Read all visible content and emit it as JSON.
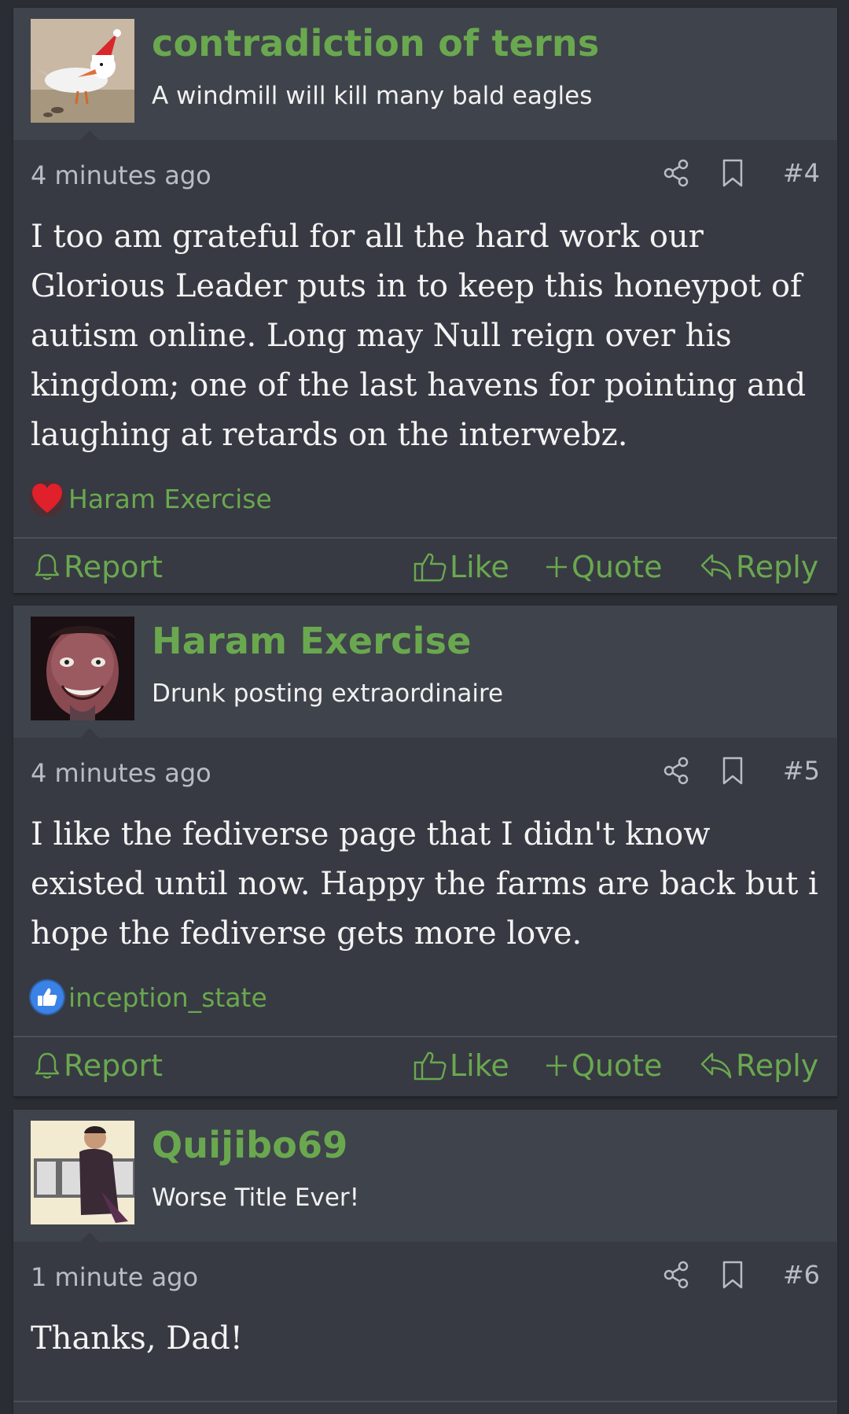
{
  "posts": [
    {
      "username": "contradiction of terns",
      "user_title": "A windmill will kill many bald eagles",
      "timestamp": "4 minutes ago",
      "post_number": "#4",
      "message": "I too am grateful for all the hard work our Glorious Leader puts in to keep this honeypot of autism online. Long may Null reign over his kingdom; one of the last havens for pointing and laughing at retards on the interwebz.",
      "reaction": {
        "icon": "heart-icon",
        "user": "Haram Exercise"
      },
      "actions": {
        "report": "Report",
        "like": "Like",
        "quote": "Quote",
        "reply": "Reply"
      }
    },
    {
      "username": "Haram Exercise",
      "user_title": "Drunk posting extraordinaire",
      "timestamp": "4 minutes ago",
      "post_number": "#5",
      "message": "I like the fediverse page that I didn't know existed until now. Happy the farms are back but i hope the fediverse gets more love.",
      "reaction": {
        "icon": "thumbs-up-icon",
        "user": "inception_state"
      },
      "actions": {
        "report": "Report",
        "like": "Like",
        "quote": "Quote",
        "reply": "Reply"
      }
    },
    {
      "username": "Quijibo69",
      "user_title": "Worse Title Ever!",
      "timestamp": "1 minute ago",
      "post_number": "#6",
      "message": "Thanks, Dad!"
    }
  ],
  "colors": {
    "accent": "#6aa84f",
    "post_bg": "#373a42",
    "header_bg": "#3f434b",
    "page_bg": "#2a2d33"
  }
}
